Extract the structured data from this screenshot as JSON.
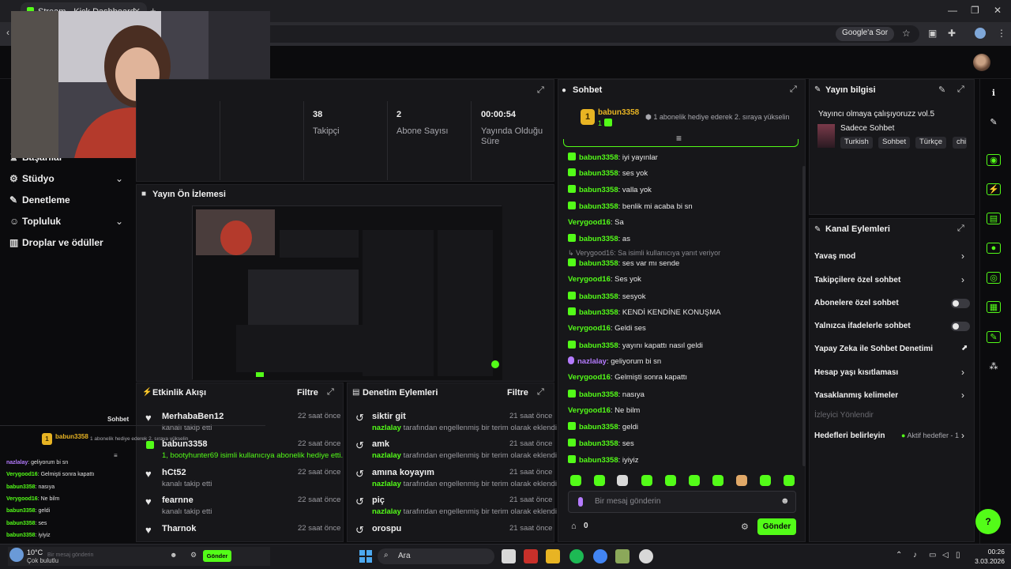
{
  "browser": {
    "tab_title": "Stream - Kick Dashboard",
    "google_sor": "Google'a Sor"
  },
  "sidebar": {
    "items": [
      {
        "label": "Başarılar",
        "icon": "trophy-icon"
      },
      {
        "label": "Stüdyo",
        "icon": "gear-icon"
      },
      {
        "label": "Denetleme",
        "icon": "wrench-icon"
      },
      {
        "label": "Topluluk",
        "icon": "users-icon"
      },
      {
        "label": "Droplar ve ödüller",
        "icon": "chart-icon"
      }
    ]
  },
  "stats": [
    {
      "value": "38",
      "label": "Takipçi"
    },
    {
      "value": "2",
      "label": "Abone Sayısı"
    },
    {
      "value": "00:00:54",
      "label": "Yayında Olduğu Süre"
    }
  ],
  "preview": {
    "title": "Yayın Ön İzlemesi"
  },
  "activity": {
    "title": "Etkinlik Akışı",
    "filter": "Filtre",
    "items": [
      {
        "name": "MerhabaBen12",
        "sub": "kanalı takip etti",
        "time": "22 saat önce",
        "type": "follow"
      },
      {
        "name": "babun3358",
        "sub": "1, bootyhunter69 isimli kullanıcıya abonelik hediye etti.",
        "time": "22 saat önce",
        "type": "gift"
      },
      {
        "name": "hCt52",
        "sub": "kanalı takip etti",
        "time": "22 saat önce",
        "type": "follow"
      },
      {
        "name": "fearnne",
        "sub": "kanalı takip etti",
        "time": "22 saat önce",
        "type": "follow"
      },
      {
        "name": "Tharnok",
        "sub": "kanalı takip etti",
        "time": "22 saat önce",
        "type": "follow"
      }
    ]
  },
  "mod": {
    "title": "Denetim Eylemleri",
    "filter": "Filtre",
    "items": [
      {
        "term": "siktir git",
        "by": "nazlalay",
        "text": "tarafından engellenmiş bir terim olarak eklendi",
        "time": "21 saat önce"
      },
      {
        "term": "amk",
        "by": "nazlalay",
        "text": "tarafından engellenmiş bir terim olarak eklendi",
        "time": "21 saat önce"
      },
      {
        "term": "amına koyayım",
        "by": "nazlalay",
        "text": "tarafından engellenmiş bir terim olarak eklendi",
        "time": "21 saat önce"
      },
      {
        "term": "piç",
        "by": "nazlalay",
        "text": "tarafından engellenmiş bir terim olarak eklendi",
        "time": "21 saat önce"
      },
      {
        "term": "orospu",
        "by": "",
        "text": "",
        "time": "21 saat önce"
      }
    ]
  },
  "chat": {
    "title": "Sohbet",
    "pinned_user": "babun3358",
    "pinned_count": "1",
    "pinned_msg": "1 abonelik hediye ederek 2. sıraya yükselin",
    "reply_note": "Verygood16: Sa isimli kullanıcıya yanıt veriyor",
    "messages": [
      {
        "user": "babun3358",
        "msg": "iyi yayınlar",
        "badge": "green"
      },
      {
        "user": "babun3358",
        "msg": "ses yok",
        "badge": "green"
      },
      {
        "user": "babun3358",
        "msg": "valla yok",
        "badge": "green"
      },
      {
        "user": "babun3358",
        "msg": "benlik mi acaba bi sn",
        "badge": "green"
      },
      {
        "user": "Verygood16",
        "msg": "Sa",
        "badge": ""
      },
      {
        "user": "babun3358",
        "msg": "as",
        "badge": "green"
      },
      {
        "user": "babun3358",
        "msg": "ses var mı sende",
        "badge": "green"
      },
      {
        "user": "Verygood16",
        "msg": "Ses yok",
        "badge": ""
      },
      {
        "user": "babun3358",
        "msg": "sesyok",
        "badge": "green"
      },
      {
        "user": "babun3358",
        "msg": "KENDİ KENDİNE KONUŞMA",
        "badge": "green"
      },
      {
        "user": "Verygood16",
        "msg": "Geldi ses",
        "badge": ""
      },
      {
        "user": "babun3358",
        "msg": "yayını kapattı nasıl geldi",
        "badge": "green"
      },
      {
        "user": "nazlalay",
        "msg": "geliyorum bi sn",
        "badge": "purple"
      },
      {
        "user": "Verygood16",
        "msg": "Gelmişti sonra kapattı",
        "badge": ""
      },
      {
        "user": "babun3358",
        "msg": "nasıya",
        "badge": "green"
      },
      {
        "user": "Verygood16",
        "msg": "Ne bilm",
        "badge": ""
      },
      {
        "user": "babun3358",
        "msg": "geldi",
        "badge": "green"
      },
      {
        "user": "babun3358",
        "msg": "ses",
        "badge": "green"
      },
      {
        "user": "babun3358",
        "msg": "iyiyiz",
        "badge": "green"
      }
    ],
    "input_placeholder": "Bir mesaj gönderin",
    "points": "0",
    "send": "Gönder"
  },
  "stream_info": {
    "title": "Yayın bilgisi",
    "stream_title": "Yayıncı olmaya çalışıyoruzz vol.5",
    "category": "Sadece Sohbet",
    "tags": [
      "Turkish",
      "Sohbet",
      "Türkçe",
      "chi"
    ]
  },
  "channel_actions": {
    "title": "Kanal Eylemleri",
    "rows": [
      {
        "label": "Yavaş mod",
        "control": "chevron"
      },
      {
        "label": "Takipçilere özel sohbet",
        "control": "chevron"
      },
      {
        "label": "Abonelere özel sohbet",
        "control": "toggle"
      },
      {
        "label": "Yalnızca ifadelerle sohbet",
        "control": "toggle"
      },
      {
        "label": "Yapay Zeka ile Sohbet Denetimi",
        "control": "external"
      },
      {
        "label": "Hesap yaşı kısıtlaması",
        "control": "chevron"
      },
      {
        "label": "Yasaklanmış kelimeler",
        "control": "chevron"
      }
    ],
    "section_label": "İzleyici Yönlendir",
    "goals_label": "Hedefleri belirleyin",
    "goals_status": "Aktif hedefler - 1"
  },
  "mini_chat": {
    "label": "Sohbet",
    "pinned_user": "babun3358",
    "pinned_msg": "1 abonelik hediye ederek 2. sıraya yükselin",
    "lines": [
      {
        "user": "nazlalay",
        "msg": "geliyorum bi sn"
      },
      {
        "user": "Verygood16",
        "msg": "Gelmişti sonra kapattı"
      },
      {
        "user": "babun3358",
        "msg": "nasıya"
      },
      {
        "user": "Verygood16",
        "msg": "Ne bilm"
      },
      {
        "user": "babun3358",
        "msg": "geldi"
      },
      {
        "user": "babun3358",
        "msg": "ses"
      },
      {
        "user": "babun3358",
        "msg": "iyiyiz"
      }
    ],
    "input_placeholder": "Bir mesaj gönderin",
    "send": "Gönder"
  },
  "taskbar": {
    "weather_temp": "10°C",
    "weather_desc": "Çok bulutlu",
    "search": "Ara",
    "time": "00:26",
    "date": "3.03.2026"
  },
  "colors": {
    "accent": "#53fc18",
    "bg": "#0b0b0d",
    "panel": "#17171a"
  }
}
